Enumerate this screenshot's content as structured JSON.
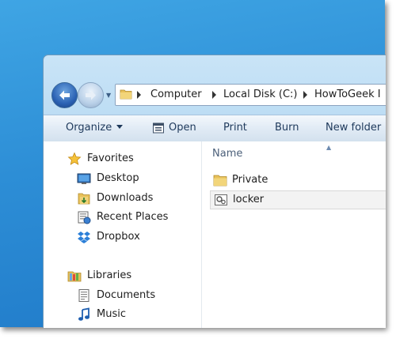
{
  "address_bar": {
    "crumbs": [
      "Computer",
      "Local Disk (C:)",
      "HowToGeek I"
    ]
  },
  "toolbar": {
    "organize_label": "Organize",
    "open_label": "Open",
    "print_label": "Print",
    "burn_label": "Burn",
    "new_folder_label": "New folder"
  },
  "nav_pane": {
    "favorites": {
      "header": "Favorites",
      "items": [
        {
          "label": "Desktop",
          "icon": "desktop-icon"
        },
        {
          "label": "Downloads",
          "icon": "downloads-icon"
        },
        {
          "label": "Recent Places",
          "icon": "recent-places-icon"
        },
        {
          "label": "Dropbox",
          "icon": "dropbox-icon"
        }
      ]
    },
    "libraries": {
      "header": "Libraries",
      "items": [
        {
          "label": "Documents",
          "icon": "documents-icon"
        },
        {
          "label": "Music",
          "icon": "music-icon"
        }
      ]
    }
  },
  "file_pane": {
    "column_header": "Name",
    "files": [
      {
        "label": "Private",
        "icon": "folder-icon",
        "selected": false
      },
      {
        "label": "locker",
        "icon": "batch-file-icon",
        "selected": true
      }
    ]
  },
  "colors": {
    "desktop": "#2d8ed6",
    "window_frame": "#b3d7f1",
    "toolbar_text": "#1e395b",
    "folder": "#e8c15a"
  }
}
